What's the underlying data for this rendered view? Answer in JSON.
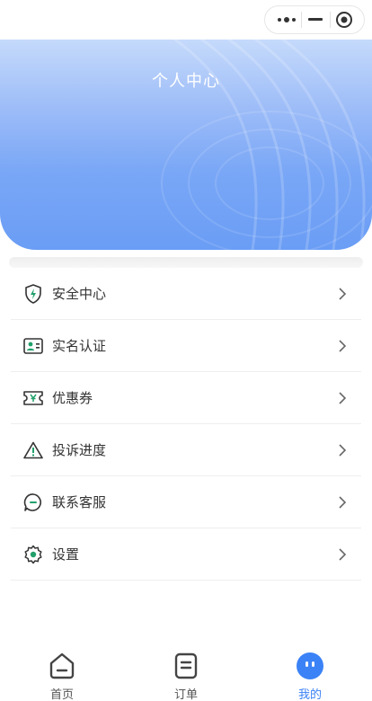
{
  "capsule": {
    "more_icon": "more-dots-icon",
    "minimize_icon": "minimize-icon",
    "close_icon": "target-close-icon"
  },
  "header": {
    "title": "个人中心"
  },
  "menu": {
    "items": [
      {
        "label": "安全中心",
        "icon": "shield-icon"
      },
      {
        "label": "实名认证",
        "icon": "id-card-icon"
      },
      {
        "label": "优惠券",
        "icon": "coupon-icon"
      },
      {
        "label": "投诉进度",
        "icon": "warning-icon"
      },
      {
        "label": "联系客服",
        "icon": "chat-icon"
      },
      {
        "label": "设置",
        "icon": "gear-icon"
      }
    ]
  },
  "tabbar": {
    "tabs": [
      {
        "label": "首页",
        "icon": "home-icon",
        "active": false
      },
      {
        "label": "订单",
        "icon": "order-icon",
        "active": false
      },
      {
        "label": "我的",
        "icon": "profile-face-icon",
        "active": true
      }
    ]
  },
  "colors": {
    "accent": "#3b82f6",
    "icon_green": "#22a06b",
    "header_top": "#c5dafb",
    "header_bottom": "#6a9df5"
  }
}
